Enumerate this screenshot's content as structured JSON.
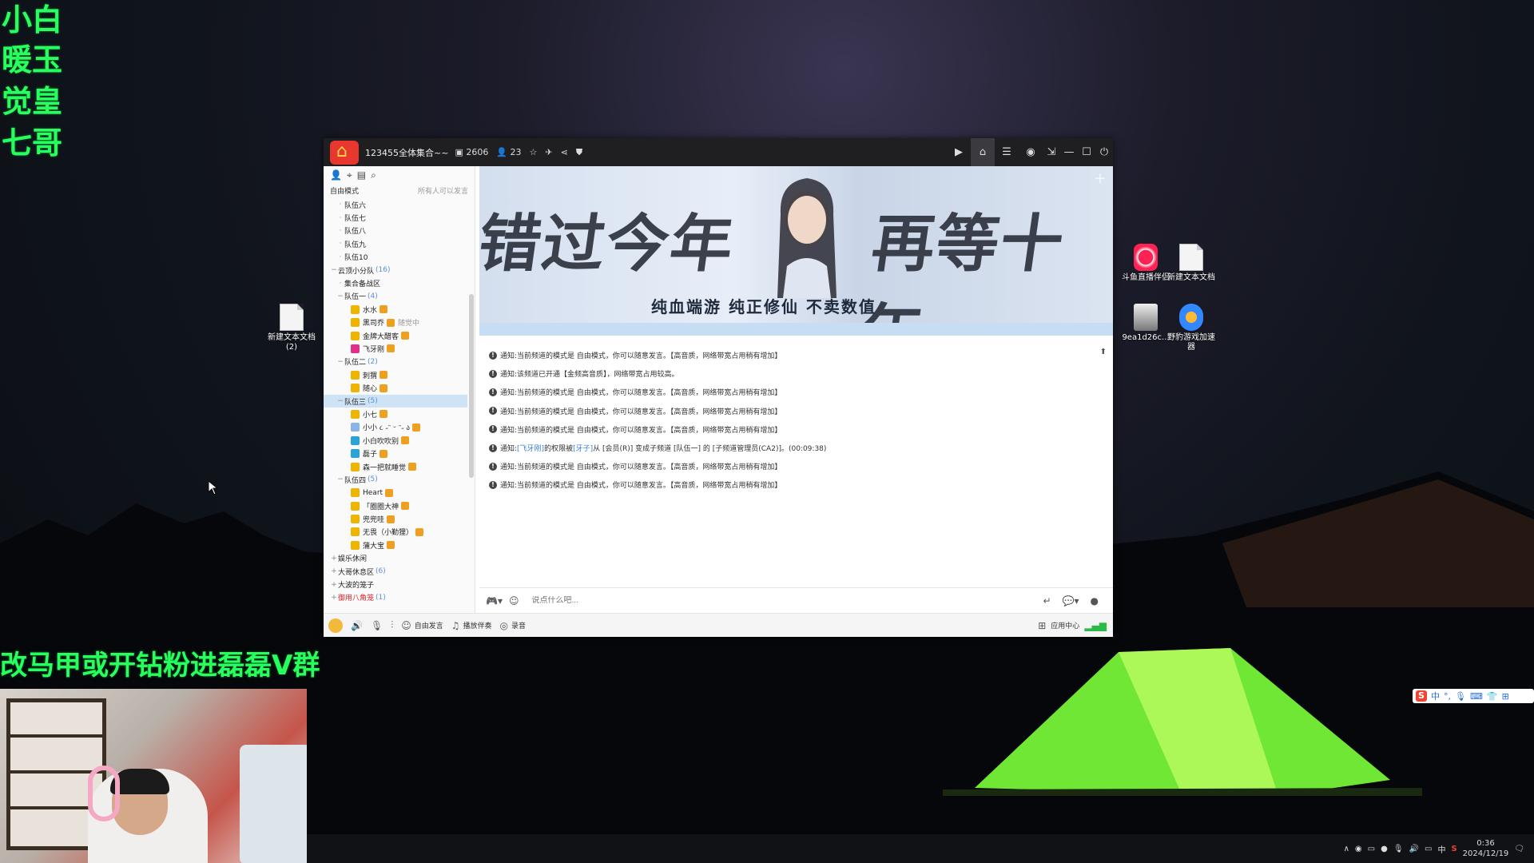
{
  "overlay": {
    "side_labels": [
      "小白",
      "暖玉",
      "觉皇",
      "七哥"
    ],
    "bottom_banner": "改马甲或开钻粉进磊磊V群"
  },
  "desktop": {
    "icons": [
      {
        "label": "新建文本文档 (2)",
        "icon": "text-file-icon"
      },
      {
        "label": "斗鱼直播伴侣",
        "icon": "douyu-icon"
      },
      {
        "label": "新建文本文档",
        "icon": "text-file-icon"
      },
      {
        "label": "9ea1d26c...",
        "icon": "image-file-icon"
      },
      {
        "label": "野豹游戏加速器",
        "icon": "accelerator-icon"
      }
    ]
  },
  "app": {
    "title": "123455全体集合~~",
    "stats": {
      "channel_count": "2606",
      "online_count": "23"
    },
    "sidebar": {
      "mode_label": "自由模式",
      "mode_hint": "所有人可以发言",
      "tree": [
        {
          "type": "channel",
          "label": "队伍六",
          "indent": 2
        },
        {
          "type": "channel",
          "label": "队伍七",
          "indent": 2
        },
        {
          "type": "channel",
          "label": "队伍八",
          "indent": 2
        },
        {
          "type": "channel",
          "label": "队伍九",
          "indent": 2
        },
        {
          "type": "channel",
          "label": "队伍10",
          "indent": 2
        },
        {
          "type": "group",
          "label": "云顶小分队",
          "count": "(16)",
          "indent": 1,
          "exp": "−"
        },
        {
          "type": "channel",
          "label": "集合备战区",
          "indent": 2
        },
        {
          "type": "group",
          "label": "队伍一",
          "count": "(4)",
          "indent": 2,
          "exp": "−"
        },
        {
          "type": "user",
          "label": "水水",
          "indent": 3,
          "color": "#f0b400"
        },
        {
          "type": "user",
          "label": "黑司乔",
          "suffix": "随觉中",
          "indent": 3,
          "color": "#f0b400"
        },
        {
          "type": "user",
          "label": "金牌大醋客",
          "indent": 3,
          "color": "#f0b400"
        },
        {
          "type": "user",
          "label": "飞牙刚",
          "indent": 3,
          "color": "#e0308a"
        },
        {
          "type": "group",
          "label": "队伍二",
          "count": "(2)",
          "indent": 2,
          "exp": "−"
        },
        {
          "type": "user",
          "label": "刺猬",
          "indent": 3,
          "color": "#f0b400"
        },
        {
          "type": "user",
          "label": "随心",
          "indent": 3,
          "color": "#f0b400"
        },
        {
          "type": "group",
          "label": "队伍三",
          "count": "(5)",
          "indent": 2,
          "exp": "−",
          "selected": true
        },
        {
          "type": "user",
          "label": "小七",
          "indent": 3,
          "color": "#f0b400"
        },
        {
          "type": "user",
          "label": "小小 ૮ ˶ᵔ ᵕ ᵔ˶ ა",
          "indent": 3,
          "color": "#8ab4e8"
        },
        {
          "type": "user",
          "label": "小白吹吹别",
          "indent": 3,
          "color": "#2aa3d8"
        },
        {
          "type": "user",
          "label": "磊子",
          "indent": 3,
          "color": "#2aa3d8"
        },
        {
          "type": "user",
          "label": "森一把就睡觉",
          "indent": 3,
          "color": "#f0b400"
        },
        {
          "type": "group",
          "label": "队伍四",
          "count": "(5)",
          "indent": 2,
          "exp": "−"
        },
        {
          "type": "user",
          "label": "Heart",
          "indent": 3,
          "color": "#f0b400"
        },
        {
          "type": "user",
          "label": "「圈圈大神",
          "indent": 3,
          "color": "#f0b400"
        },
        {
          "type": "user",
          "label": "兜兜哇",
          "indent": 3,
          "color": "#f0b400"
        },
        {
          "type": "user",
          "label": "无畏（小勤狸）",
          "indent": 3,
          "color": "#f0b400"
        },
        {
          "type": "user",
          "label": "蒲大宝",
          "indent": 3,
          "color": "#f0b400"
        },
        {
          "type": "group",
          "label": "娱乐休闲",
          "indent": 1,
          "exp": "+"
        },
        {
          "type": "group",
          "label": "大哥休息区",
          "count": "(6)",
          "indent": 1,
          "exp": "+"
        },
        {
          "type": "group",
          "label": "大波的笼子",
          "indent": 1,
          "exp": "+"
        },
        {
          "type": "group",
          "label": "御用八角笼",
          "count": "(1)",
          "indent": 1,
          "exp": "+",
          "red": true
        }
      ]
    },
    "banner": {
      "left_text": "错过今年",
      "right_text": "再等十年",
      "subtitle": "纯血端游  纯正修仙  不卖数值"
    },
    "messages": [
      {
        "prefix": "通知:",
        "text": "当前频道的模式是 自由模式，你可以随意发言。【高音质，网络带宽占用稍有增加】"
      },
      {
        "prefix": "通知:",
        "text": "该频道已开通【金频高音质】，网络带宽占用较高。"
      },
      {
        "prefix": "通知:",
        "text": "当前频道的模式是 自由模式，你可以随意发言。【高音质，网络带宽占用稍有增加】"
      },
      {
        "prefix": "通知:",
        "text": "当前频道的模式是 自由模式，你可以随意发言。【高音质，网络带宽占用稍有增加】"
      },
      {
        "prefix": "通知:",
        "text": "当前频道的模式是 自由模式，你可以随意发言。【高音质，网络带宽占用稍有增加】"
      },
      {
        "prefix": "通知:",
        "user1": "[飞牙刚]",
        "mid1": " 的权限被 ",
        "user2": "[牙子]",
        "text": " 从 [会员(R)] 变成子频道 [队伍一] 的 [子频道管理员(CA2)]。(00:09:38)"
      },
      {
        "prefix": "通知:",
        "text": "当前频道的模式是 自由模式，你可以随意发言。【高音质，网络带宽占用稍有增加】"
      },
      {
        "prefix": "通知:",
        "text": "当前频道的模式是 自由模式，你可以随意发言。【高音质，网络带宽占用稍有增加】"
      }
    ],
    "input": {
      "placeholder": "说点什么吧..."
    },
    "bottom": {
      "free_speak": "自由发言",
      "music": "播放伴奏",
      "record": "录音",
      "app_center": "应用中心"
    }
  },
  "taskbar": {
    "time": "0:36",
    "date": "2024/12/19",
    "ime_lang": "中"
  },
  "colors": {
    "accent_green": "#28ff5c",
    "link_blue": "#3a7fd5",
    "titlebar": "#1f1f22"
  }
}
